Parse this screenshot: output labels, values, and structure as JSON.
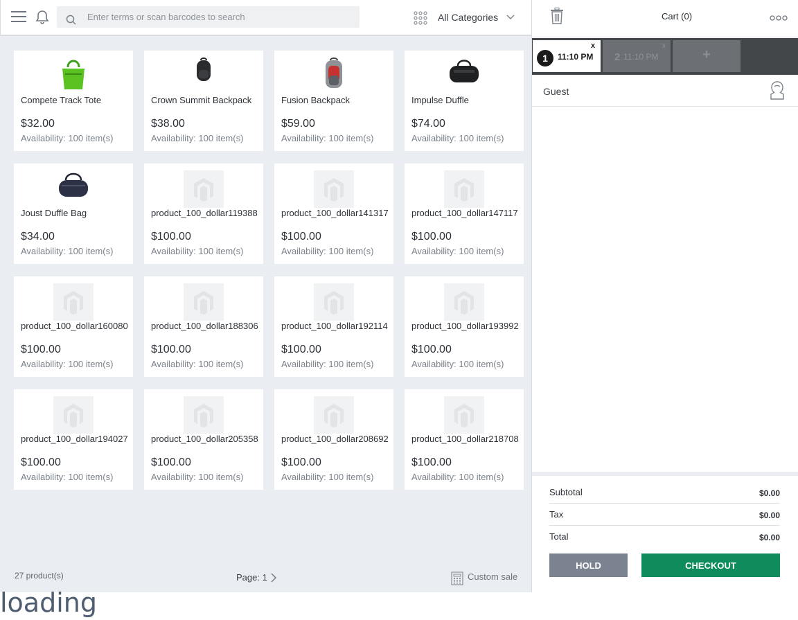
{
  "search": {
    "placeholder": "Enter terms or scan barcodes to search"
  },
  "category": {
    "label": "All Categories"
  },
  "products": [
    {
      "name": "Compete Track Tote",
      "price": "$32.00",
      "availability": "Availability: 100 item(s)",
      "image": "green-tote"
    },
    {
      "name": "Crown Summit Backpack",
      "price": "$38.00",
      "availability": "Availability: 100 item(s)",
      "image": "black-backpack"
    },
    {
      "name": "Fusion Backpack",
      "price": "$59.00",
      "availability": "Availability: 100 item(s)",
      "image": "grey-red-backpack"
    },
    {
      "name": "Impulse Duffle",
      "price": "$74.00",
      "availability": "Availability: 100 item(s)",
      "image": "black-duffle"
    },
    {
      "name": "Joust Duffle Bag",
      "price": "$34.00",
      "availability": "Availability: 100 item(s)",
      "image": "navy-duffle"
    },
    {
      "name": "product_100_dollar119388",
      "price": "$100.00",
      "availability": "Availability: 100 item(s)",
      "image": "placeholder"
    },
    {
      "name": "product_100_dollar141317",
      "price": "$100.00",
      "availability": "Availability: 100 item(s)",
      "image": "placeholder"
    },
    {
      "name": "product_100_dollar147117",
      "price": "$100.00",
      "availability": "Availability: 100 item(s)",
      "image": "placeholder"
    },
    {
      "name": "product_100_dollar160080",
      "price": "$100.00",
      "availability": "Availability: 100 item(s)",
      "image": "placeholder"
    },
    {
      "name": "product_100_dollar188306",
      "price": "$100.00",
      "availability": "Availability: 100 item(s)",
      "image": "placeholder"
    },
    {
      "name": "product_100_dollar192114",
      "price": "$100.00",
      "availability": "Availability: 100 item(s)",
      "image": "placeholder"
    },
    {
      "name": "product_100_dollar193992",
      "price": "$100.00",
      "availability": "Availability: 100 item(s)",
      "image": "placeholder"
    },
    {
      "name": "product_100_dollar194027",
      "price": "$100.00",
      "availability": "Availability: 100 item(s)",
      "image": "placeholder"
    },
    {
      "name": "product_100_dollar205358",
      "price": "$100.00",
      "availability": "Availability: 100 item(s)",
      "image": "placeholder"
    },
    {
      "name": "product_100_dollar208692",
      "price": "$100.00",
      "availability": "Availability: 100 item(s)",
      "image": "placeholder"
    },
    {
      "name": "product_100_dollar218708",
      "price": "$100.00",
      "availability": "Availability: 100 item(s)",
      "image": "placeholder"
    }
  ],
  "footer": {
    "count": "27 product(s)",
    "page": "Page: 1",
    "custom_sale": "Custom sale"
  },
  "cart": {
    "title": "Cart (0)",
    "tabs": [
      {
        "num": "1",
        "time": "11:10 PM",
        "close": "x",
        "active": true
      },
      {
        "num": "2",
        "time": "11:10 PM",
        "close": "x",
        "active": false
      }
    ],
    "add_tab": "+",
    "customer": "Guest",
    "totals": [
      {
        "label": "Subtotal",
        "value": "$0.00"
      },
      {
        "label": "Tax",
        "value": "$0.00"
      },
      {
        "label": "Total",
        "value": "$0.00"
      }
    ],
    "hold": "HOLD",
    "checkout": "CHECKOUT"
  },
  "status": {
    "loading": "loading"
  },
  "colors": {
    "checkout": "#0e8c5b",
    "hold": "#7b8390",
    "tabbar": "#434649",
    "background": "#eaedf1"
  }
}
